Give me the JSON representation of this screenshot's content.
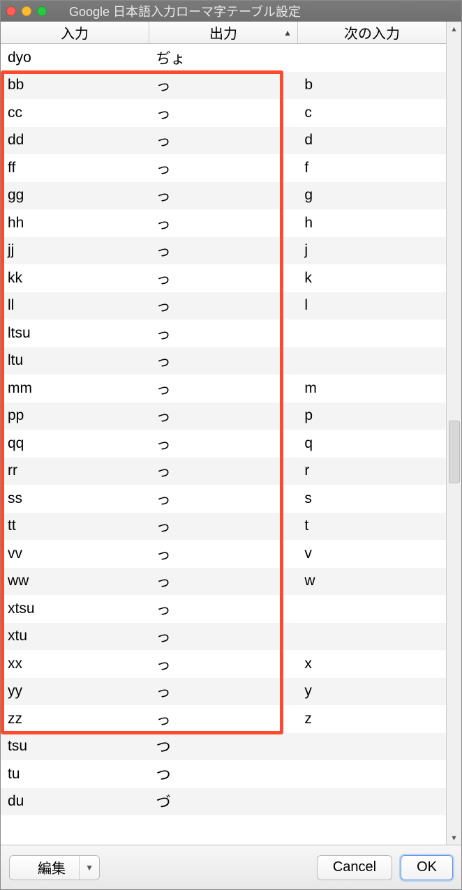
{
  "window": {
    "title": "Google 日本語入力ローマ字テーブル設定"
  },
  "columns": {
    "input": "入力",
    "output": "出力",
    "next": "次の入力",
    "sorted": "output"
  },
  "rows": [
    {
      "in": "dyo",
      "out": "ぢょ",
      "next": ""
    },
    {
      "in": "bb",
      "out": "っ",
      "next": "b"
    },
    {
      "in": "cc",
      "out": "っ",
      "next": "c"
    },
    {
      "in": "dd",
      "out": "っ",
      "next": "d"
    },
    {
      "in": "ff",
      "out": "っ",
      "next": "f"
    },
    {
      "in": "gg",
      "out": "っ",
      "next": "g"
    },
    {
      "in": "hh",
      "out": "っ",
      "next": "h"
    },
    {
      "in": "jj",
      "out": "っ",
      "next": "j"
    },
    {
      "in": "kk",
      "out": "っ",
      "next": "k"
    },
    {
      "in": "ll",
      "out": "っ",
      "next": "l"
    },
    {
      "in": "ltsu",
      "out": "っ",
      "next": ""
    },
    {
      "in": "ltu",
      "out": "っ",
      "next": ""
    },
    {
      "in": "mm",
      "out": "っ",
      "next": "m"
    },
    {
      "in": "pp",
      "out": "っ",
      "next": "p"
    },
    {
      "in": "qq",
      "out": "っ",
      "next": "q"
    },
    {
      "in": "rr",
      "out": "っ",
      "next": "r"
    },
    {
      "in": "ss",
      "out": "っ",
      "next": "s"
    },
    {
      "in": "tt",
      "out": "っ",
      "next": "t"
    },
    {
      "in": "vv",
      "out": "っ",
      "next": "v"
    },
    {
      "in": "ww",
      "out": "っ",
      "next": "w"
    },
    {
      "in": "xtsu",
      "out": "っ",
      "next": ""
    },
    {
      "in": "xtu",
      "out": "っ",
      "next": ""
    },
    {
      "in": "xx",
      "out": "っ",
      "next": "x"
    },
    {
      "in": "yy",
      "out": "っ",
      "next": "y"
    },
    {
      "in": "zz",
      "out": "っ",
      "next": "z"
    },
    {
      "in": "tsu",
      "out": "つ",
      "next": ""
    },
    {
      "in": "tu",
      "out": "つ",
      "next": ""
    },
    {
      "in": "du",
      "out": "づ",
      "next": ""
    }
  ],
  "highlight": {
    "startRow": 1,
    "endRow": 24
  },
  "footer": {
    "edit": "編集",
    "cancel": "Cancel",
    "ok": "OK"
  },
  "scroll": {
    "thumbTop": 540,
    "thumbHeight": 90
  }
}
